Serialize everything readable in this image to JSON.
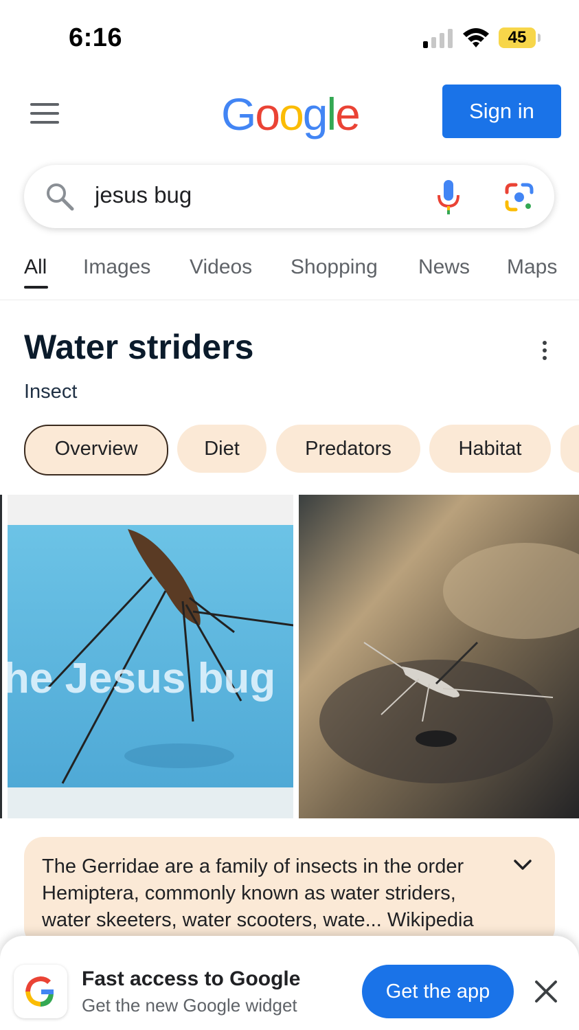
{
  "status_bar": {
    "time": "6:16",
    "battery": "45"
  },
  "header": {
    "logo": [
      "G",
      "o",
      "o",
      "g",
      "l",
      "e"
    ],
    "logo_colors": [
      "#4285F4",
      "#EA4335",
      "#FBBC05",
      "#4285F4",
      "#34A853",
      "#EA4335"
    ],
    "sign_in": "Sign in"
  },
  "search": {
    "query": "jesus bug"
  },
  "tabs": [
    "All",
    "Images",
    "Videos",
    "Shopping",
    "News",
    "Maps"
  ],
  "knowledge_panel": {
    "title": "Water striders",
    "subtitle": "Insect",
    "chips": [
      "Overview",
      "Diet",
      "Predators",
      "Habitat"
    ],
    "image_caption": "he Jesus bug",
    "description": "The Gerridae are a family of insects in the order Hemiptera, commonly known as water striders, water skeeters, water scooters, wate... Wikipedia"
  },
  "promo": {
    "title": "Fast access to Google",
    "subtitle": "Get the new Google widget",
    "button": "Get the app"
  },
  "colors": {
    "accent": "#1a73e8",
    "chip_bg": "#fbe9d6",
    "battery": "#f7d64a"
  }
}
